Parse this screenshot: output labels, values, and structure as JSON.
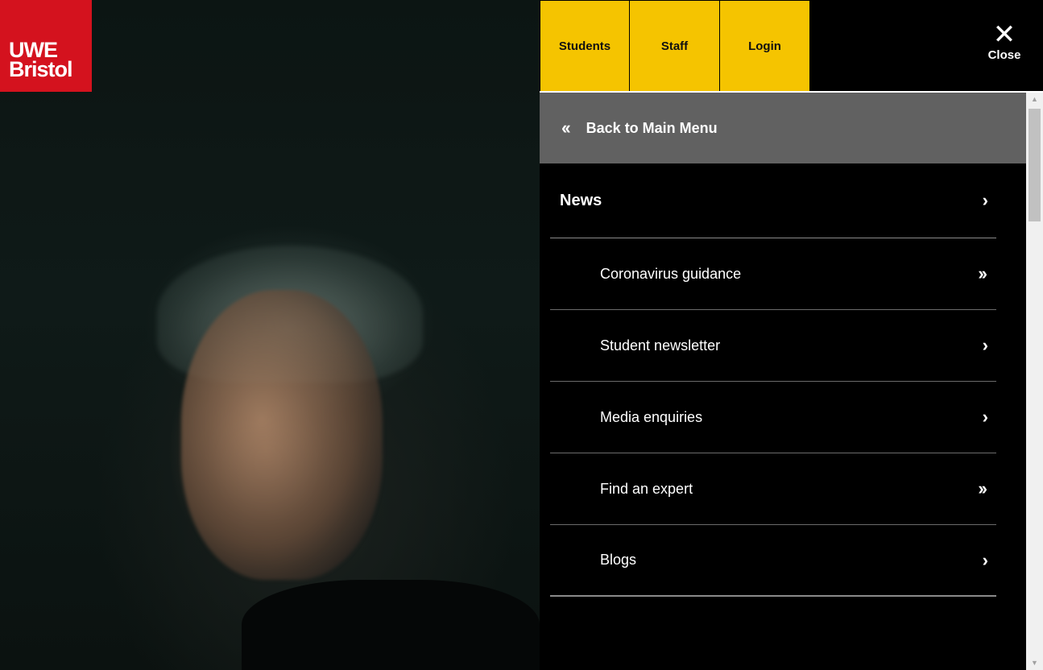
{
  "logo": {
    "line1": "UWE",
    "line2": "Bristol",
    "color": "#d4121e"
  },
  "topnav": {
    "accent_color": "#f5c400",
    "tabs": [
      {
        "label": "Students"
      },
      {
        "label": "Staff"
      },
      {
        "label": "Login"
      }
    ]
  },
  "close": {
    "icon": "close-icon",
    "glyph": "✕",
    "label": "Close"
  },
  "back": {
    "icon": "double-chevron-left-icon",
    "glyph": "«",
    "label": "Back to Main Menu"
  },
  "menu": {
    "heading": {
      "label": "News",
      "icon": "chevron-right-icon",
      "glyph": "›"
    },
    "items": [
      {
        "label": "Coronavirus guidance",
        "icon": "double-chevron-right-icon",
        "glyph": "»"
      },
      {
        "label": "Student newsletter",
        "icon": "chevron-right-icon",
        "glyph": "›"
      },
      {
        "label": "Media enquiries",
        "icon": "chevron-right-icon",
        "glyph": "›"
      },
      {
        "label": "Find an expert",
        "icon": "double-chevron-right-icon",
        "glyph": "»"
      },
      {
        "label": "Blogs",
        "icon": "chevron-right-icon",
        "glyph": "›"
      }
    ]
  }
}
